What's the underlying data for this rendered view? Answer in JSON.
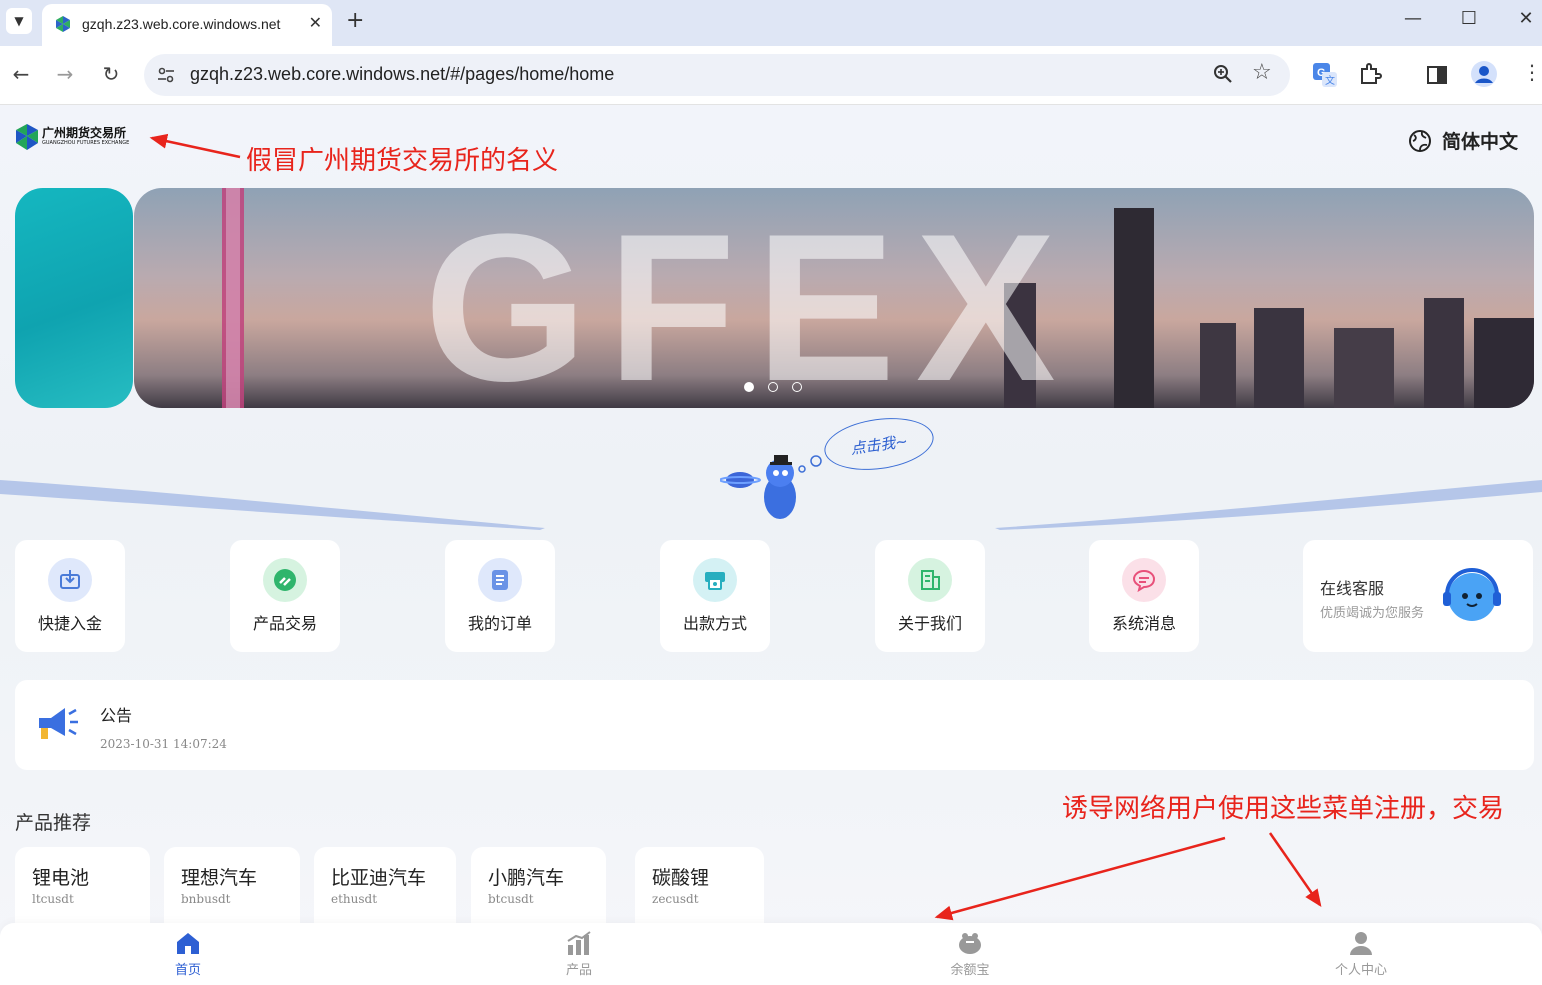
{
  "browser": {
    "tab_title": "gzqh.z23.web.core.windows.net",
    "tab_close": "✕",
    "new_tab": "+",
    "url": "gzqh.z23.web.core.windows.net/#/pages/home/home",
    "window_controls": {
      "minimize": "—",
      "maximize": "☐",
      "close": "✕"
    },
    "icons": [
      "chevron-down-icon",
      "back-icon",
      "forward-icon",
      "reload-icon",
      "site-info-icon",
      "zoom-icon",
      "bookmark-star-icon",
      "translate-icon",
      "extensions-icon",
      "side-panel-icon",
      "profile-icon",
      "more-menu-icon"
    ]
  },
  "header": {
    "logo_cn": "广州期货交易所",
    "logo_en": "GUANGZHOU FUTURES EXCHANGE",
    "language": "简体中文"
  },
  "annotations": {
    "top": "假冒广州期货交易所的名义",
    "bottom": "诱导网络用户使用这些菜单注册，交易",
    "color": "#e8241c"
  },
  "banner": {
    "text": "GFEX",
    "dots": 3,
    "active_dot": 0
  },
  "mascot": {
    "bubble": "点击我~"
  },
  "quick_menu": [
    {
      "label": "快捷入金",
      "icon": "deposit-icon",
      "color": "#4a7bd8"
    },
    {
      "label": "产品交易",
      "icon": "trade-icon",
      "color": "#2fb56c"
    },
    {
      "label": "我的订单",
      "icon": "order-icon",
      "color": "#4a7bd8"
    },
    {
      "label": "出款方式",
      "icon": "withdraw-icon",
      "color": "#27aebf"
    },
    {
      "label": "关于我们",
      "icon": "building-icon",
      "color": "#2fb56c"
    },
    {
      "label": "系统消息",
      "icon": "message-icon",
      "color": "#e8507a"
    }
  ],
  "customer_service": {
    "title": "在线客服",
    "subtitle": "优质竭诚为您服务"
  },
  "notice": {
    "title": "公告",
    "time": "2023-10-31 14:07:24"
  },
  "recommend": {
    "title": "产品推荐",
    "products": [
      {
        "name": "锂电池",
        "code": "ltcusdt"
      },
      {
        "name": "理想汽车",
        "code": "bnbusdt"
      },
      {
        "name": "比亚迪汽车",
        "code": "ethusdt"
      },
      {
        "name": "小鹏汽车",
        "code": "btcusdt"
      },
      {
        "name": "碳酸锂",
        "code": "zecusdt"
      }
    ]
  },
  "bottom_nav": [
    {
      "label": "首页",
      "active": true
    },
    {
      "label": "产品",
      "active": false
    },
    {
      "label": "余额宝",
      "active": false
    },
    {
      "label": "个人中心",
      "active": false
    }
  ]
}
